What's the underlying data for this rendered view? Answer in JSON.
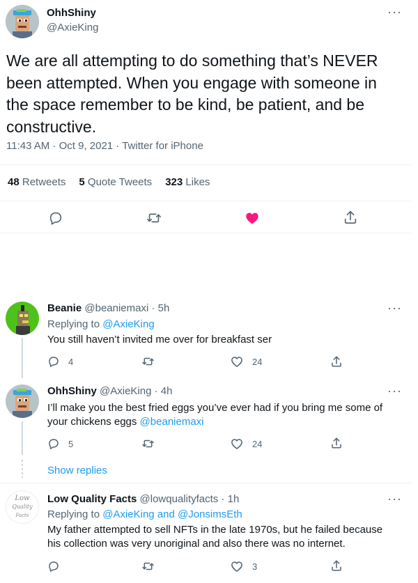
{
  "main_tweet": {
    "name": "OhhShiny",
    "handle": "@AxieKing",
    "text": "We are all attempting to do something that’s NEVER been attempted. When you engage with someone in the space remember to be kind, be patient, and be constructive.",
    "timestamp": "11:43 AM · Oct 9, 2021 · Twitter for iPhone",
    "stats": {
      "retweets_count": "48",
      "retweets_label": "Retweets",
      "quotes_count": "5",
      "quotes_label": "Quote Tweets",
      "likes_count": "323",
      "likes_label": "Likes"
    },
    "actions": [
      "reply-icon",
      "retweet-icon",
      "heart-filled-icon",
      "share-icon"
    ],
    "like_color": "#f91880"
  },
  "replies": [
    {
      "name": "Beanie",
      "handle": "@beaniemaxi",
      "time": "· 5h",
      "replying_prefix": "Replying to",
      "replying_to": "@AxieKing",
      "text": "You still haven’t invited me over for breakfast ser",
      "reply_count": "4",
      "retweet_count": "",
      "like_count": "24"
    },
    {
      "name": "OhhShiny",
      "handle": "@AxieKing",
      "time": "· 4h",
      "text_before": "I’ll make you the best fried eggs you’ve ever had if you bring me some of your chickens eggs",
      "text_mention": "@beaniemaxi",
      "reply_count": "5",
      "retweet_count": "",
      "like_count": "24"
    },
    {
      "name": "Low Quality Facts",
      "handle": "@lowqualityfacts",
      "time": "· 1h",
      "replying_prefix": "Replying to",
      "replying_to": "@AxieKing and @JonsimsEth",
      "avatar_text_1": "Low",
      "avatar_text_2": "Quality",
      "avatar_text_3": "Facts",
      "text": "My father attempted to sell NFTs in the late 1970s, but he failed because his collection was very unoriginal and also there was no internet.",
      "reply_count": "",
      "retweet_count": "",
      "like_count": "3"
    }
  ],
  "show_replies": "Show replies",
  "more_glyph": "···",
  "colors": {
    "accent": "#1d9bf0",
    "text": "#0f1419",
    "muted": "#536471",
    "divider": "#eff3f4"
  }
}
